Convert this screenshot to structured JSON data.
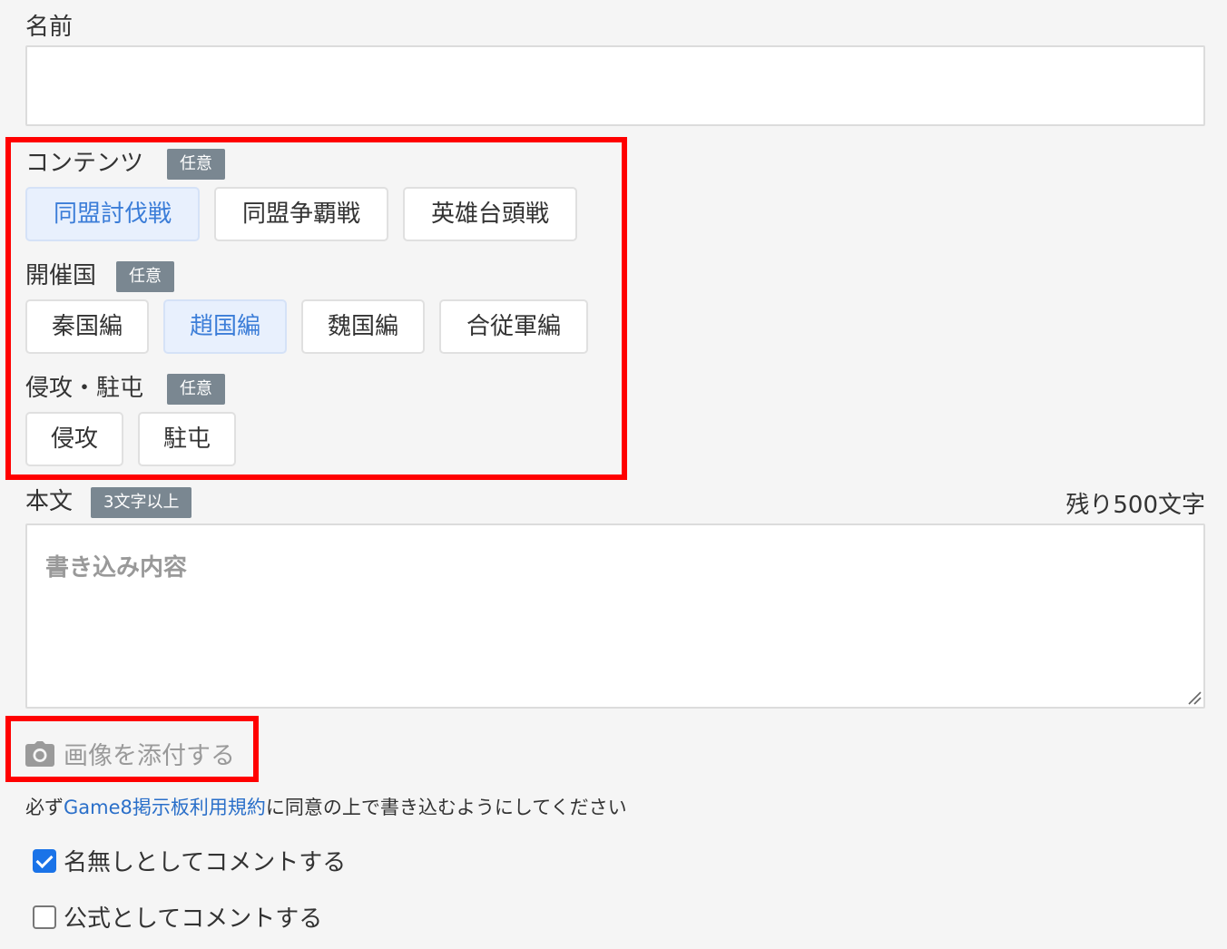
{
  "name_field": {
    "label": "名前",
    "value": ""
  },
  "contents": {
    "label": "コンテンツ",
    "badge": "任意",
    "options": [
      "同盟討伐戦",
      "同盟争覇戦",
      "英雄台頭戦"
    ],
    "selected": "同盟討伐戦"
  },
  "host_country": {
    "label": "開催国",
    "badge": "任意",
    "options": [
      "秦国編",
      "趙国編",
      "魏国編",
      "合従軍編"
    ],
    "selected": "趙国編"
  },
  "invade_station": {
    "label": "侵攻・駐屯",
    "badge": "任意",
    "options": [
      "侵攻",
      "駐屯"
    ]
  },
  "body": {
    "label": "本文",
    "badge": "3文字以上",
    "remaining": "残り500文字",
    "placeholder": "書き込み内容"
  },
  "attach": {
    "label": "画像を添付する",
    "icon": "camera-icon"
  },
  "terms": {
    "prefix": "必ず",
    "link": "Game8掲示板利用規約",
    "suffix": "に同意の上で書き込むようにしてください"
  },
  "checkboxes": [
    {
      "label": "名無しとしてコメントする",
      "checked": true
    },
    {
      "label": "公式としてコメントする",
      "checked": false
    }
  ],
  "colors": {
    "highlight_red": "#ff0000",
    "selected_text": "#3b7dd8",
    "link": "#2a6fc9",
    "badge": "#7a8791"
  }
}
